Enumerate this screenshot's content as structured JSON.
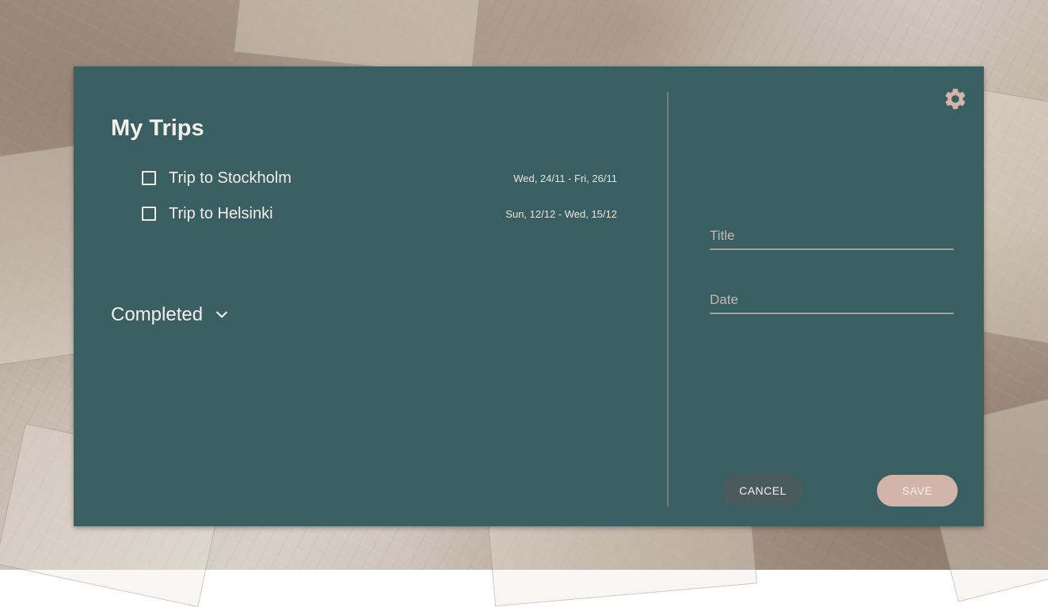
{
  "trips_panel": {
    "title": "My Trips",
    "trips": [
      {
        "name": "Trip to Stockholm",
        "dates": "Wed, 24/11 - Fri, 26/11",
        "checked": false
      },
      {
        "name": "Trip to Helsinki",
        "dates": "Sun, 12/12 - Wed, 15/12",
        "checked": false
      }
    ],
    "completed_label": "Completed"
  },
  "form": {
    "title_placeholder": "Title",
    "date_placeholder": "Date",
    "cancel_label": "CANCEL",
    "save_label": "SAVE"
  },
  "icons": {
    "settings": "gear-icon",
    "expand": "chevron-down-icon"
  },
  "colors": {
    "panel": "#3a5f62",
    "accent": "#d2b4a8",
    "secondary_button": "#4b5a5c"
  }
}
